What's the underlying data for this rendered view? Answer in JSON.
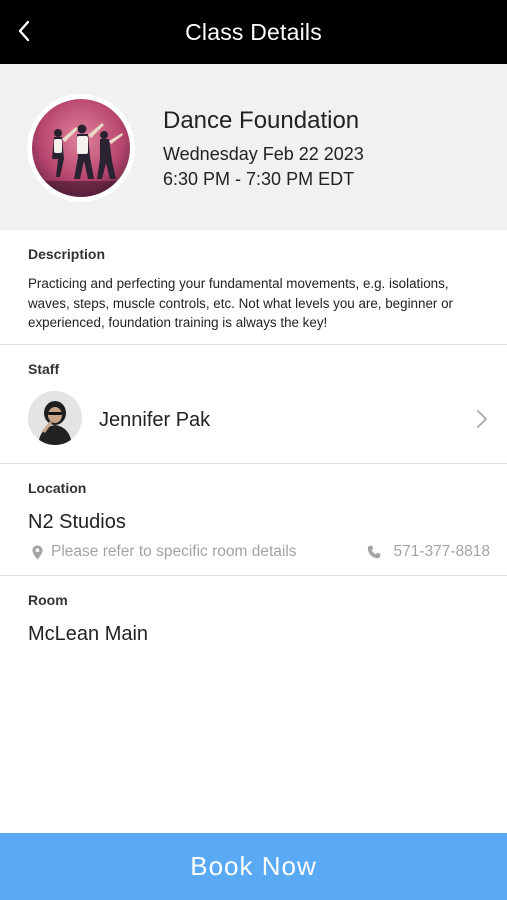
{
  "header": {
    "title": "Class Details",
    "back_icon": "chevron-left-icon"
  },
  "class": {
    "name": "Dance Foundation",
    "date": "Wednesday Feb 22 2023",
    "time": "6:30 PM - 7:30 PM EDT",
    "image": "dance-group-photo"
  },
  "description": {
    "label": "Description",
    "text": "Practicing and perfecting your fundamental movements, e.g. isolations, waves, steps, muscle controls, etc. Not what levels you are, beginner or experienced, foundation training is always the key!"
  },
  "staff": {
    "label": "Staff",
    "name": "Jennifer Pak",
    "photo": "staff-portrait"
  },
  "location": {
    "label": "Location",
    "name": "N2 Studios",
    "detail": "Please refer to specific room details",
    "phone": "571-377-8818"
  },
  "room": {
    "label": "Room",
    "name": "McLean Main"
  },
  "actions": {
    "book_label": "Book Now"
  },
  "colors": {
    "header_bg": "#000000",
    "hero_bg": "#f1f1f1",
    "accent": "#5aa9f5",
    "muted_text": "#a3a3a3",
    "divider": "#dedede"
  }
}
